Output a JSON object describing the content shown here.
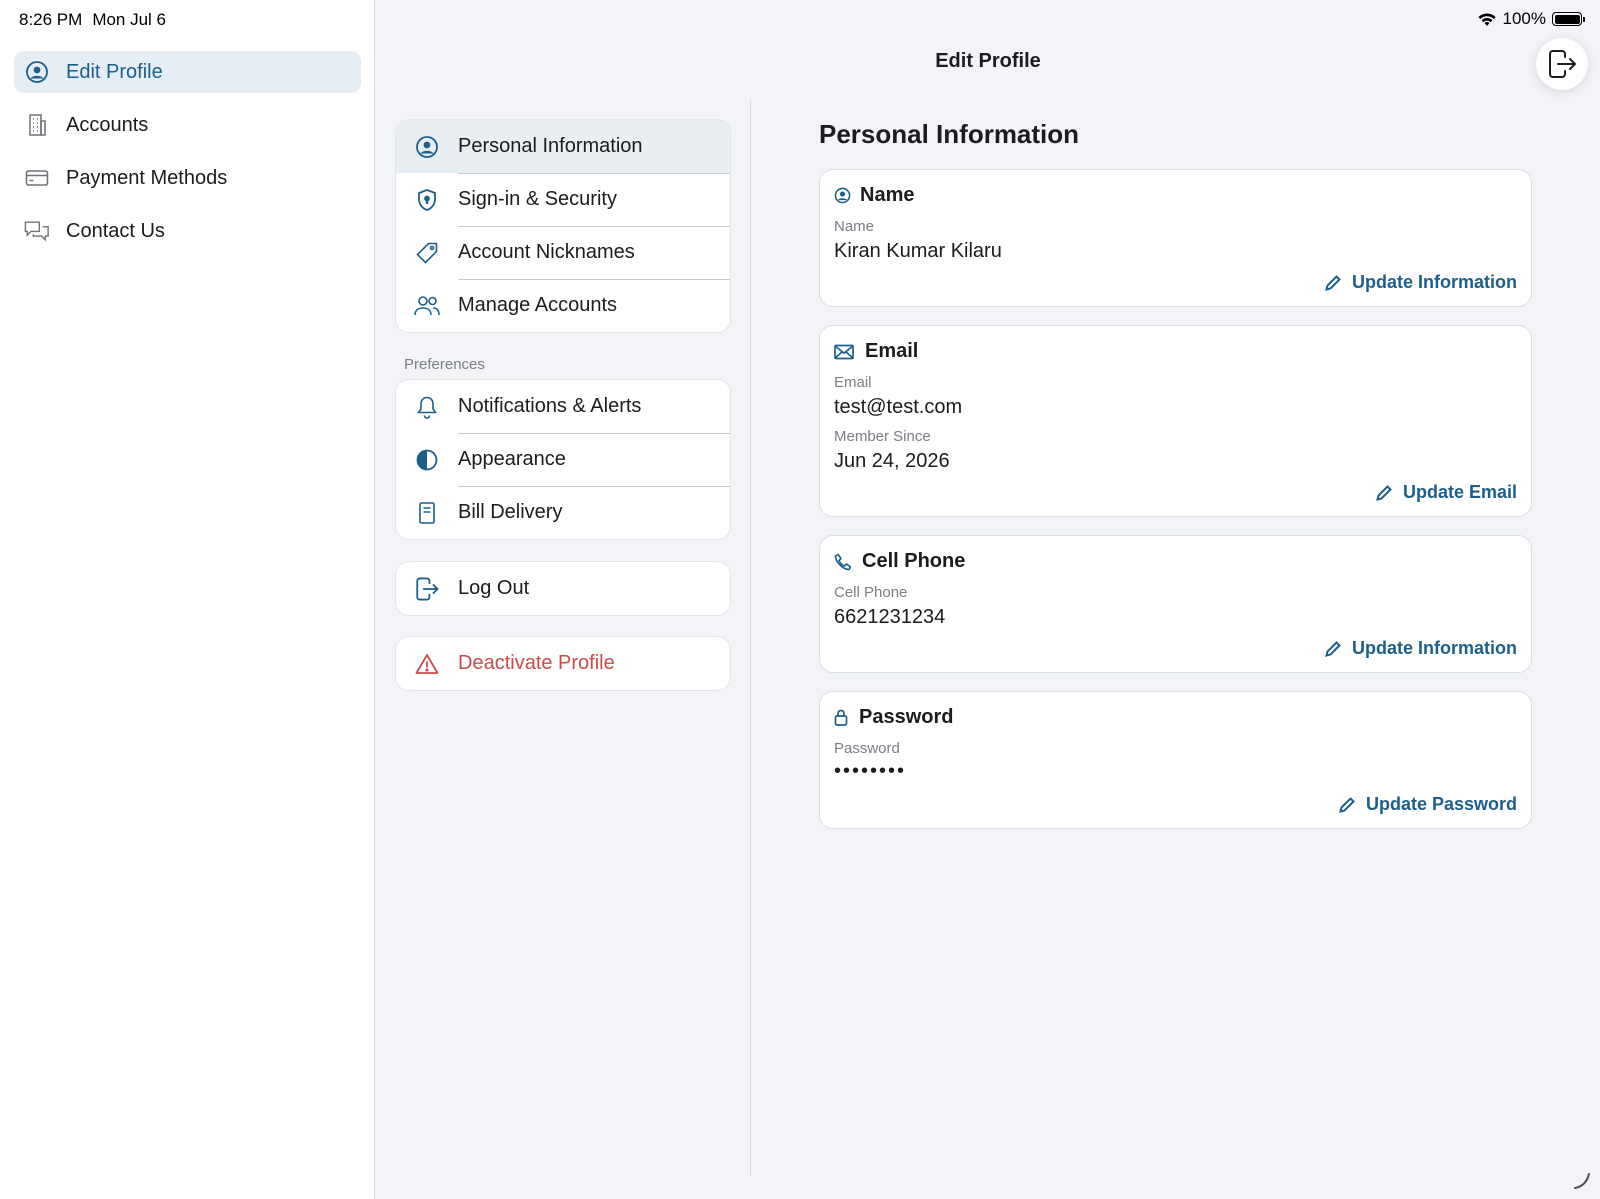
{
  "status": {
    "time": "8:26 PM",
    "date": "Mon Jul 6",
    "battery": "100%"
  },
  "colors": {
    "accent": "#1d5f8a",
    "danger": "#cc4b4b",
    "background": "#f3f4f8"
  },
  "sidebar": {
    "items": [
      {
        "label": "Edit Profile",
        "icon": "person-circle-icon",
        "active": true
      },
      {
        "label": "Accounts",
        "icon": "building-icon"
      },
      {
        "label": "Payment Methods",
        "icon": "credit-card-icon"
      },
      {
        "label": "Contact Us",
        "icon": "chat-bubbles-icon"
      }
    ]
  },
  "header": {
    "title": "Edit Profile"
  },
  "menu": {
    "account_items": [
      {
        "label": "Personal Information",
        "icon": "person-circle-icon",
        "selected": true
      },
      {
        "label": "Sign-in & Security",
        "icon": "shield-icon"
      },
      {
        "label": "Account Nicknames",
        "icon": "tag-icon"
      },
      {
        "label": "Manage Accounts",
        "icon": "people-icon"
      }
    ],
    "preferences_label": "Preferences",
    "preference_items": [
      {
        "label": "Notifications & Alerts",
        "icon": "bell-icon"
      },
      {
        "label": "Appearance",
        "icon": "contrast-icon"
      },
      {
        "label": "Bill Delivery",
        "icon": "document-icon"
      }
    ],
    "logout_label": "Log Out",
    "deactivate_label": "Deactivate Profile"
  },
  "content": {
    "title": "Personal Information",
    "name_card": {
      "heading": "Name",
      "field_label": "Name",
      "value": "Kiran Kumar Kilaru",
      "action": "Update Information"
    },
    "email_card": {
      "heading": "Email",
      "email_label": "Email",
      "email_value": "test@test.com",
      "member_label": "Member Since",
      "member_value": "Jun 24, 2026",
      "action": "Update Email"
    },
    "phone_card": {
      "heading": "Cell Phone",
      "field_label": "Cell Phone",
      "value": "6621231234",
      "action": "Update Information"
    },
    "password_card": {
      "heading": "Password",
      "field_label": "Password",
      "value": "••••••••",
      "action": "Update Password"
    }
  }
}
